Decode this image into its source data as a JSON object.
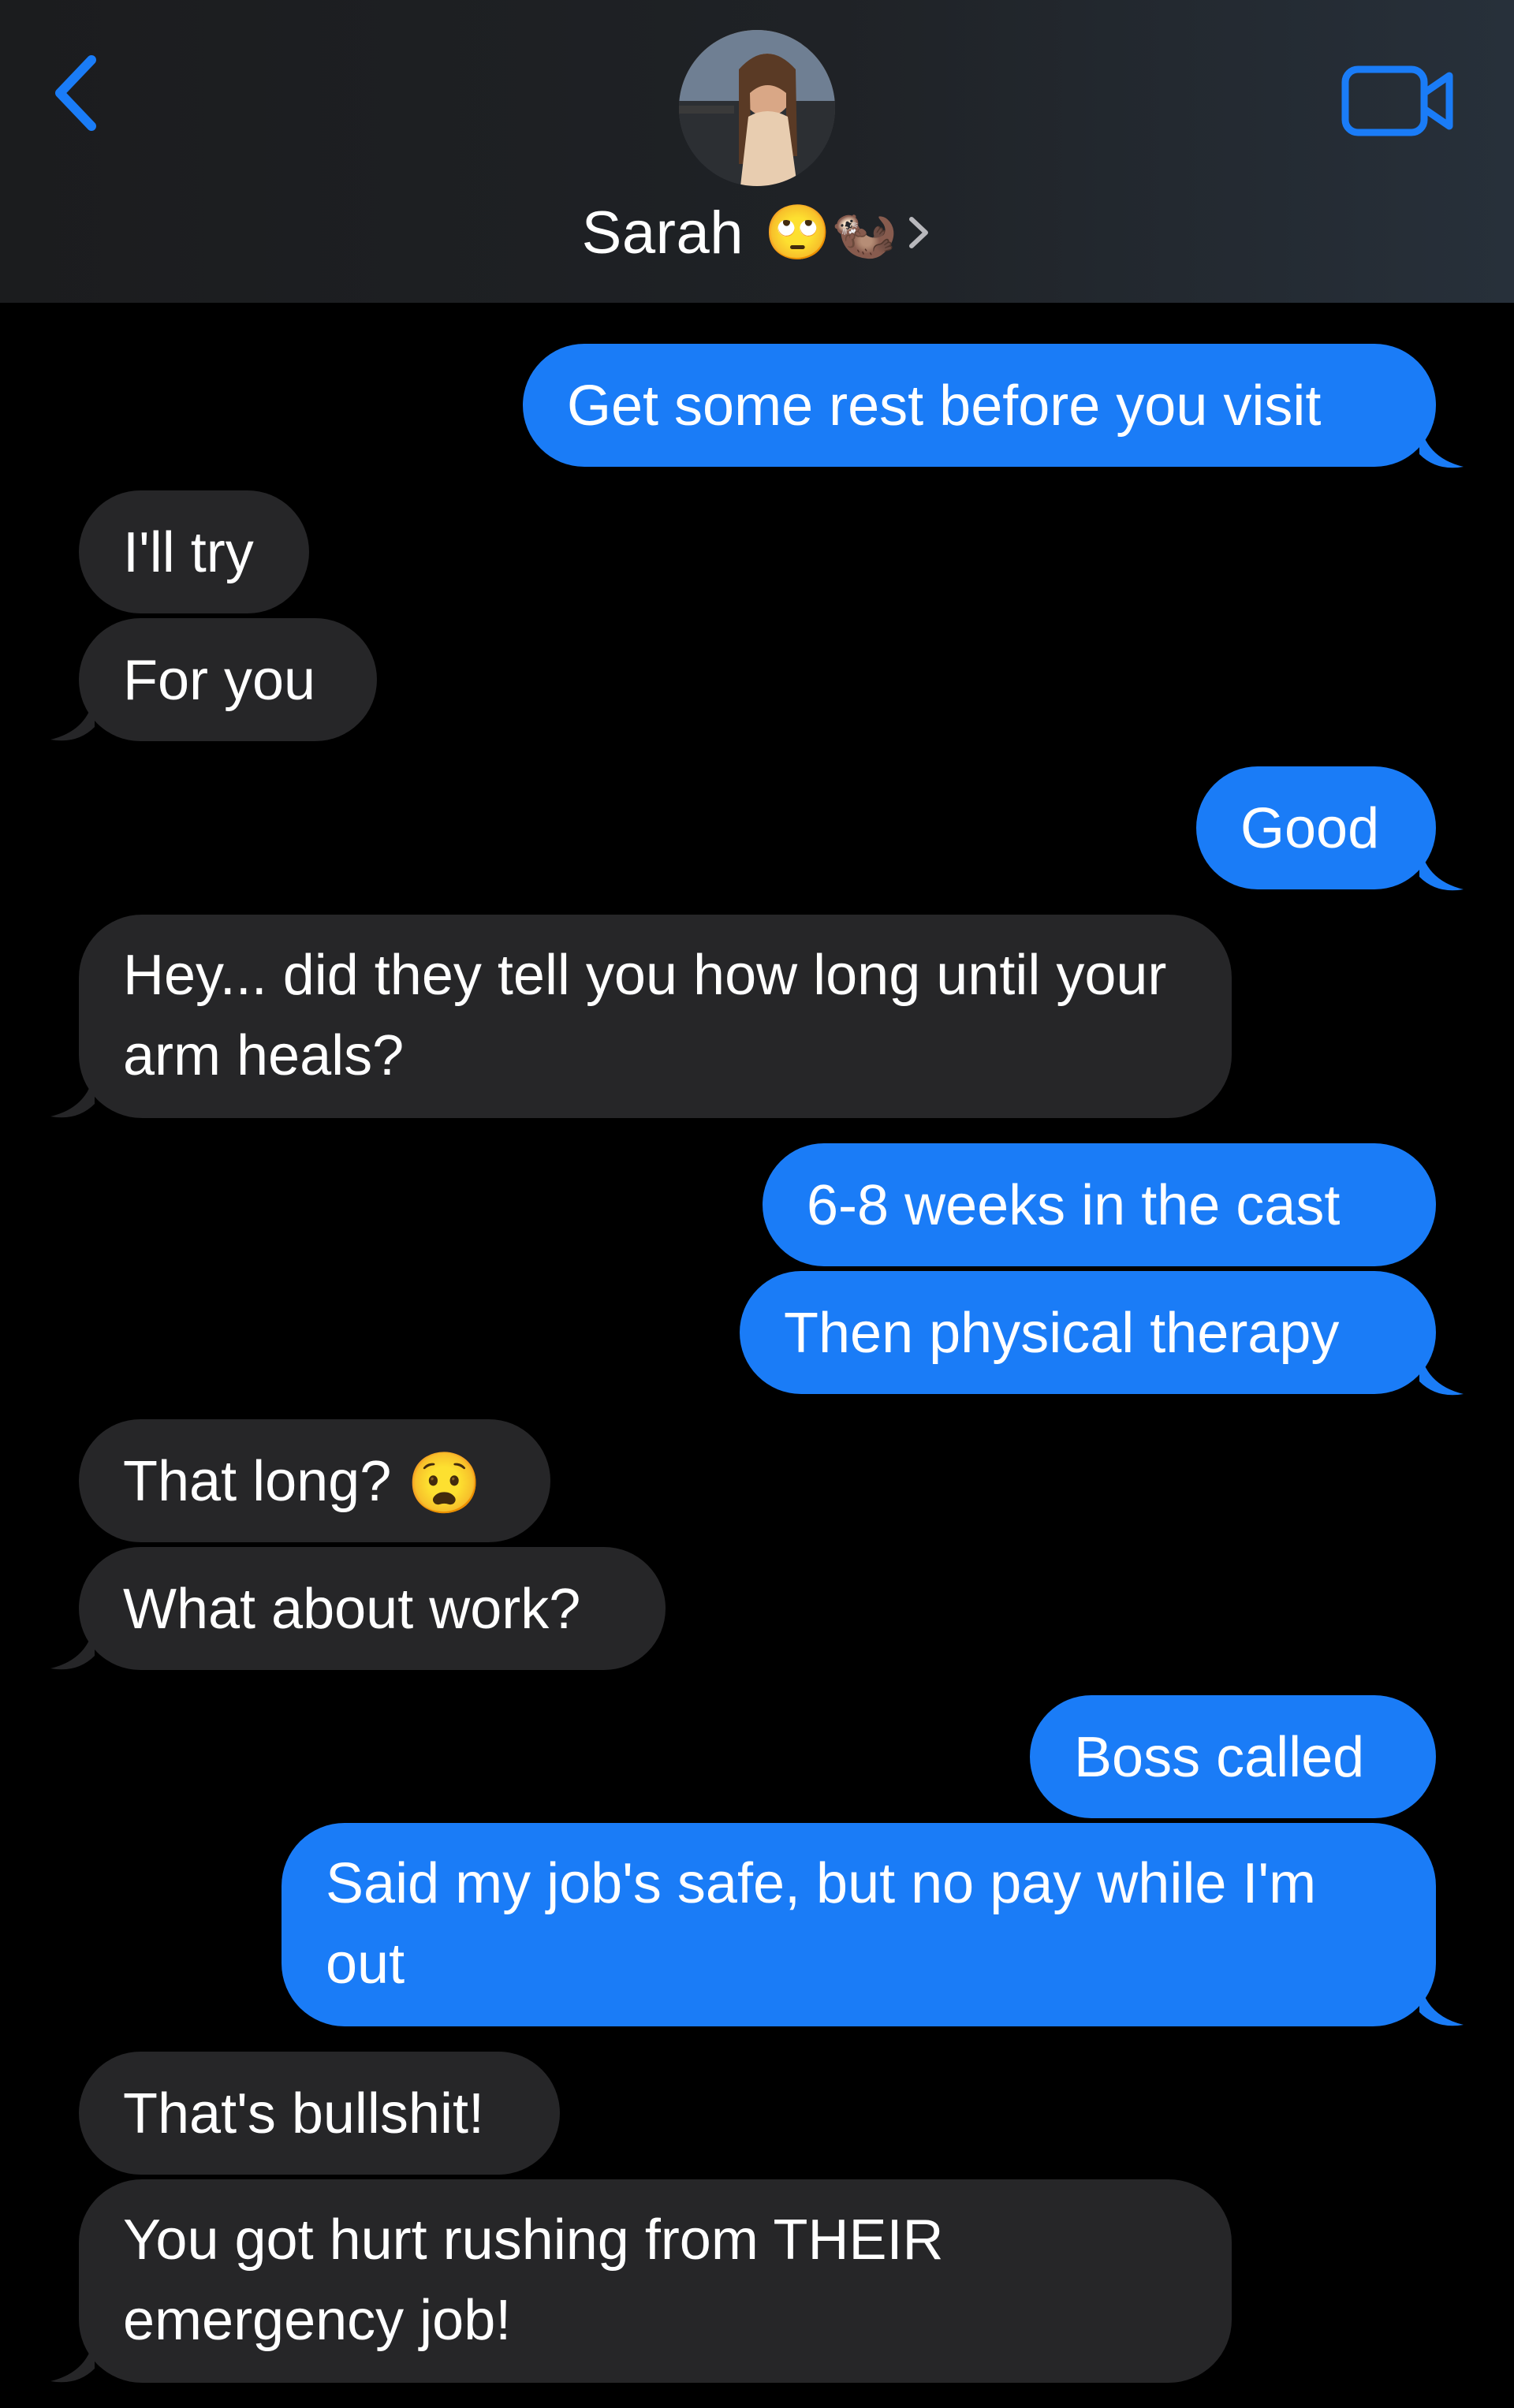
{
  "header": {
    "contact_name": "Sarah",
    "name_emojis": [
      "🙄",
      "🦦"
    ],
    "accent_color": "#1a7cf7",
    "icons": {
      "back": "chevron-left-icon",
      "name_chevron": "chevron-right-icon",
      "video": "video-camera-icon"
    }
  },
  "messages": [
    {
      "from": "me",
      "text": "Get some rest before you visit"
    },
    {
      "from": "sarah",
      "text": "I'll try"
    },
    {
      "from": "sarah",
      "text": "For you"
    },
    {
      "from": "me",
      "text": "Good"
    },
    {
      "from": "sarah",
      "text": "Hey... did they tell you how long until your arm heals?"
    },
    {
      "from": "me",
      "text": "6-8 weeks in the cast"
    },
    {
      "from": "me",
      "text": "Then physical therapy"
    },
    {
      "from": "sarah",
      "text": "That long?",
      "emoji": "😧"
    },
    {
      "from": "sarah",
      "text": "What about work?"
    },
    {
      "from": "me",
      "text": "Boss called"
    },
    {
      "from": "me",
      "text": "Said my job's safe, but no pay while I'm out"
    },
    {
      "from": "sarah",
      "text": "That's bullshit!"
    },
    {
      "from": "sarah",
      "text": "You got hurt rushing from THEIR emergency job!"
    }
  ],
  "colors": {
    "sent_bubble": "#1a7cf7",
    "received_bubble": "#262628",
    "background": "#000000"
  }
}
